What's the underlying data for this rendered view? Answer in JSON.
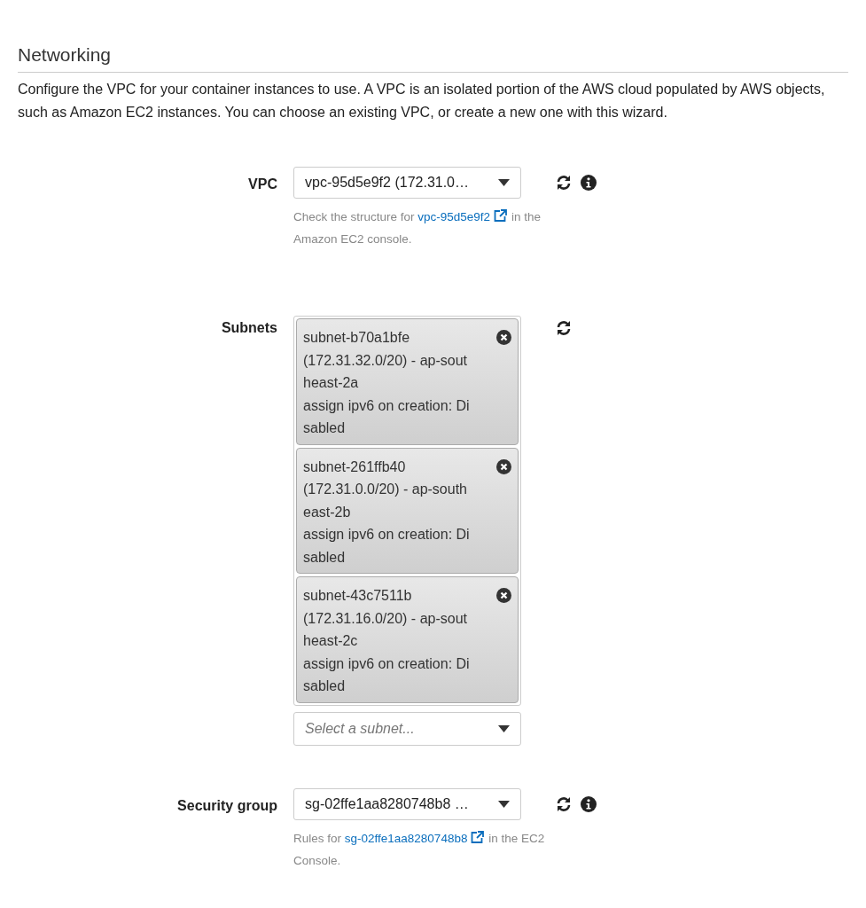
{
  "section": {
    "title": "Networking",
    "description": "Configure the VPC for your container instances to use. A VPC is an isolated portion of the AWS cloud populated by AWS objects, such as Amazon EC2 instances. You can choose an existing VPC, or create a new one with this wizard."
  },
  "fields": [
    {
      "kind": "select",
      "label": "VPC",
      "value": "vpc-95d5e9f2 (172.31.0…",
      "refresh": true,
      "info": true,
      "help": {
        "before": "Check the structure for",
        "link": "vpc-95d5e9f2",
        "after": "in the Amazon EC2 console."
      }
    },
    {
      "kind": "multi",
      "label": "Subnets",
      "refresh": true,
      "info": false,
      "chips": [
        {
          "lines": [
            "subnet-b70a1bfe",
            "(172.31.32.0/20) - ap-sout",
            "heast-2a",
            "assign ipv6 on creation: Di",
            "sabled"
          ]
        },
        {
          "lines": [
            "subnet-261ffb40",
            "(172.31.0.0/20) - ap-south",
            "east-2b",
            "assign ipv6 on creation: Di",
            "sabled"
          ]
        },
        {
          "lines": [
            "subnet-43c7511b",
            "(172.31.16.0/20) - ap-sout",
            "heast-2c",
            "assign ipv6 on creation: Di",
            "sabled"
          ]
        }
      ],
      "placeholder": "Select a subnet..."
    },
    {
      "kind": "select",
      "label": "Security group",
      "value": "sg-02ffe1aa8280748b8 …",
      "refresh": true,
      "info": true,
      "help": {
        "before": "Rules for",
        "link": "sg-02ffe1aa8280748b8",
        "after": "in the EC2 Console."
      }
    }
  ]
}
